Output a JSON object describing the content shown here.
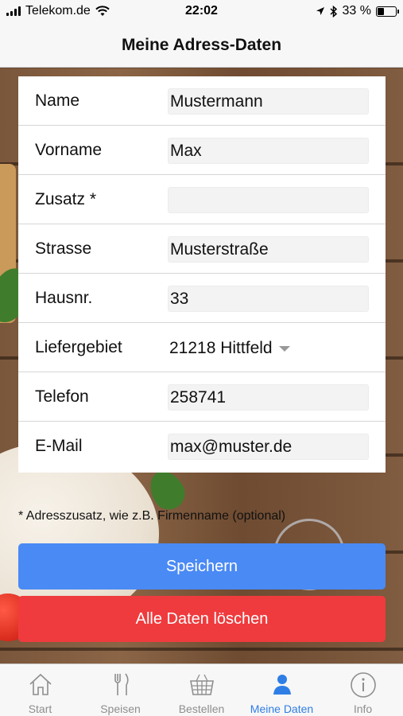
{
  "status_bar": {
    "carrier": "Telekom.de",
    "time": "22:02",
    "battery_percent": "33 %",
    "battery_level": 0.33
  },
  "header": {
    "title": "Meine Adress-Daten"
  },
  "form": {
    "rows": [
      {
        "label": "Name",
        "value": "Mustermann"
      },
      {
        "label": "Vorname",
        "value": "Max"
      },
      {
        "label": "Zusatz *",
        "value": ""
      },
      {
        "label": "Strasse",
        "value": "Musterstraße"
      },
      {
        "label": "Hausnr.",
        "value": "33"
      },
      {
        "label": "Liefergebiet",
        "value": "21218 Hittfeld"
      },
      {
        "label": "Telefon",
        "value": "258741"
      },
      {
        "label": "E-Mail",
        "value": "max@muster.de"
      }
    ]
  },
  "note": "* Adresszusatz, wie z.B. Firmenname (optional)",
  "buttons": {
    "save": "Speichern",
    "delete": "Alle Daten löschen"
  },
  "tabs": [
    {
      "label": "Start",
      "icon": "home-icon"
    },
    {
      "label": "Speisen",
      "icon": "fork-knife-icon"
    },
    {
      "label": "Bestellen",
      "icon": "basket-icon"
    },
    {
      "label": "Meine Daten",
      "icon": "person-icon"
    },
    {
      "label": "Info",
      "icon": "info-icon"
    }
  ],
  "colors": {
    "accent_blue": "#4a8af4",
    "danger_red": "#ef3b3d",
    "active_tab": "#2f7ee6"
  }
}
